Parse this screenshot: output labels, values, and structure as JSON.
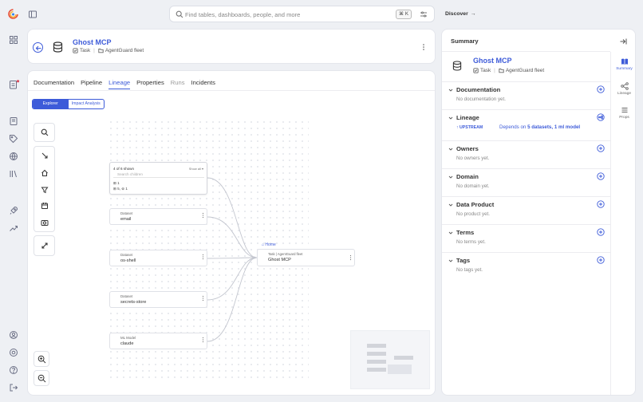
{
  "search": {
    "placeholder": "Find tables, dashboards, people, and more",
    "shortcut": "⌘ K"
  },
  "topbar": {
    "discover_label": "Discover",
    "discover_arrow": "→"
  },
  "entity": {
    "title": "Ghost MCP",
    "type": "Task",
    "container": "AgentGuard fleet"
  },
  "tabs": [
    {
      "label": "Documentation"
    },
    {
      "label": "Pipeline"
    },
    {
      "label": "Lineage"
    },
    {
      "label": "Properties"
    },
    {
      "label": "Runs"
    },
    {
      "label": "Incidents"
    }
  ],
  "view_toggle": {
    "explorer": "Explorer",
    "impact": "Impact Analysis"
  },
  "graph": {
    "group": {
      "count": "4 of 6 shown",
      "show_all": "Show all ▾",
      "search_placeholder": "Search children",
      "row1": "1",
      "row2_a": "5",
      "row2_b": "1"
    },
    "nodes": [
      {
        "type": "Dataset",
        "name": "email"
      },
      {
        "type": "Dataset",
        "name": "os-shell"
      },
      {
        "type": "Dataset",
        "name": "secrets-store"
      },
      {
        "type": "ML Model",
        "name": "claude"
      }
    ],
    "home_label": "Home",
    "center": {
      "type": "Task",
      "container": "AgentGuard fleet",
      "name": "Ghost MCP"
    }
  },
  "panel": {
    "title": "Summary",
    "nav": [
      {
        "label": "Summary"
      },
      {
        "label": "Lineage"
      },
      {
        "label": "Props"
      }
    ],
    "sections": [
      {
        "name": "Documentation",
        "empty": "No documentation yet."
      },
      {
        "name": "Lineage",
        "upstream": "UPSTREAM",
        "dep_prefix": "Depends on",
        "dep_bold": "5 datasets, 1 ml model"
      },
      {
        "name": "Owners",
        "empty": "No owners yet."
      },
      {
        "name": "Domain",
        "empty": "No domain yet."
      },
      {
        "name": "Data Product",
        "empty": "No product yet."
      },
      {
        "name": "Terms",
        "empty": "No terms yet."
      },
      {
        "name": "Tags",
        "empty": "No tags yet."
      }
    ]
  },
  "colors": {
    "accent": "#3d5bd9",
    "page_bg": "#eef0f4",
    "notification_dot": "#d94a5c",
    "logo_red": "#e8503a",
    "logo_yellow": "#f3b33d",
    "logo_blue": "#2f80ed"
  }
}
